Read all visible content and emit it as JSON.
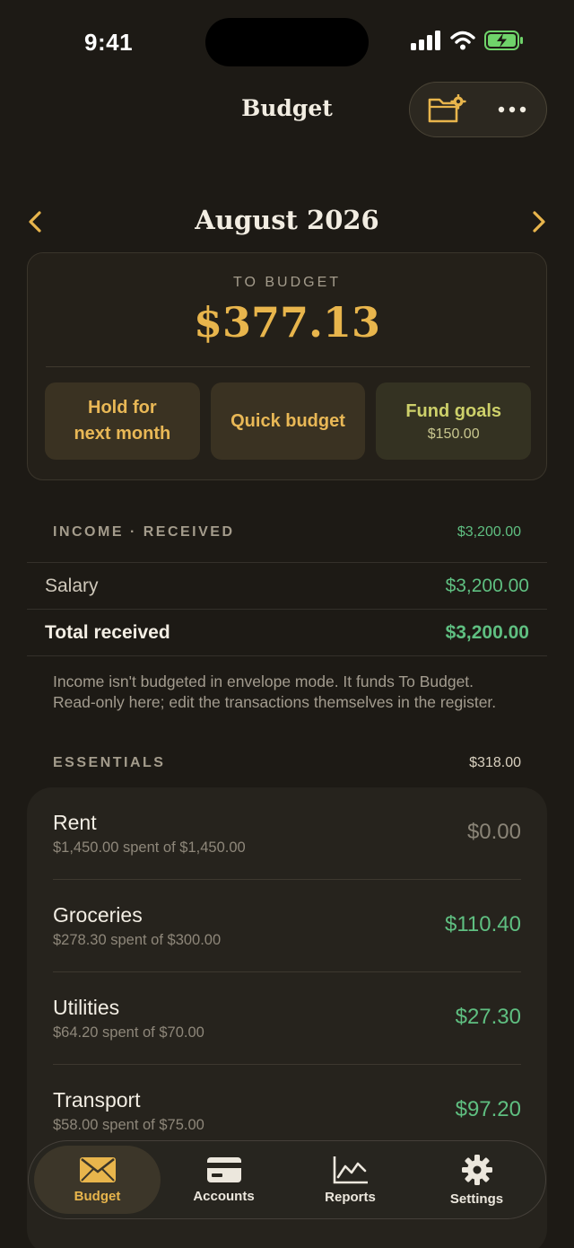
{
  "status_bar": {
    "time": "9:41"
  },
  "header": {
    "title": "Budget"
  },
  "month_nav": {
    "month": "August 2026"
  },
  "to_budget": {
    "label": "TO BUDGET",
    "amount": "$377.13",
    "actions": {
      "hold_line1": "Hold for",
      "hold_line2": "next month",
      "quick": "Quick budget",
      "fund_goals": "Fund goals",
      "fund_goals_amount": "$150.00"
    }
  },
  "income": {
    "label": "INCOME · RECEIVED",
    "total": "$3,200.00",
    "rows": [
      {
        "name": "Salary",
        "value": "$3,200.00"
      }
    ],
    "total_row": {
      "name": "Total received",
      "value": "$3,200.00"
    },
    "note": "Income isn't budgeted in envelope mode. It funds To Budget. Read-only here; edit the transactions themselves in the register."
  },
  "essentials": {
    "label": "ESSENTIALS",
    "total": "$318.00",
    "categories": [
      {
        "name": "Rent",
        "detail": "$1,450.00 spent of $1,450.00",
        "available": "$0.00"
      },
      {
        "name": "Groceries",
        "detail": "$278.30 spent of $300.00",
        "available": "$110.40"
      },
      {
        "name": "Utilities",
        "detail": "$64.20 spent of $70.00",
        "available": "$27.30"
      },
      {
        "name": "Transport",
        "detail": "$58.00 spent of $75.00",
        "available": "$97.20"
      }
    ]
  },
  "tabs": [
    {
      "label": "Budget",
      "icon": "envelope-icon"
    },
    {
      "label": "Accounts",
      "icon": "card-icon"
    },
    {
      "label": "Reports",
      "icon": "chart-icon"
    },
    {
      "label": "Settings",
      "icon": "gear-icon"
    }
  ],
  "colors": {
    "background": "#1d1a15",
    "accent_gold": "#e8b54c",
    "positive_green": "#5fbf81"
  }
}
